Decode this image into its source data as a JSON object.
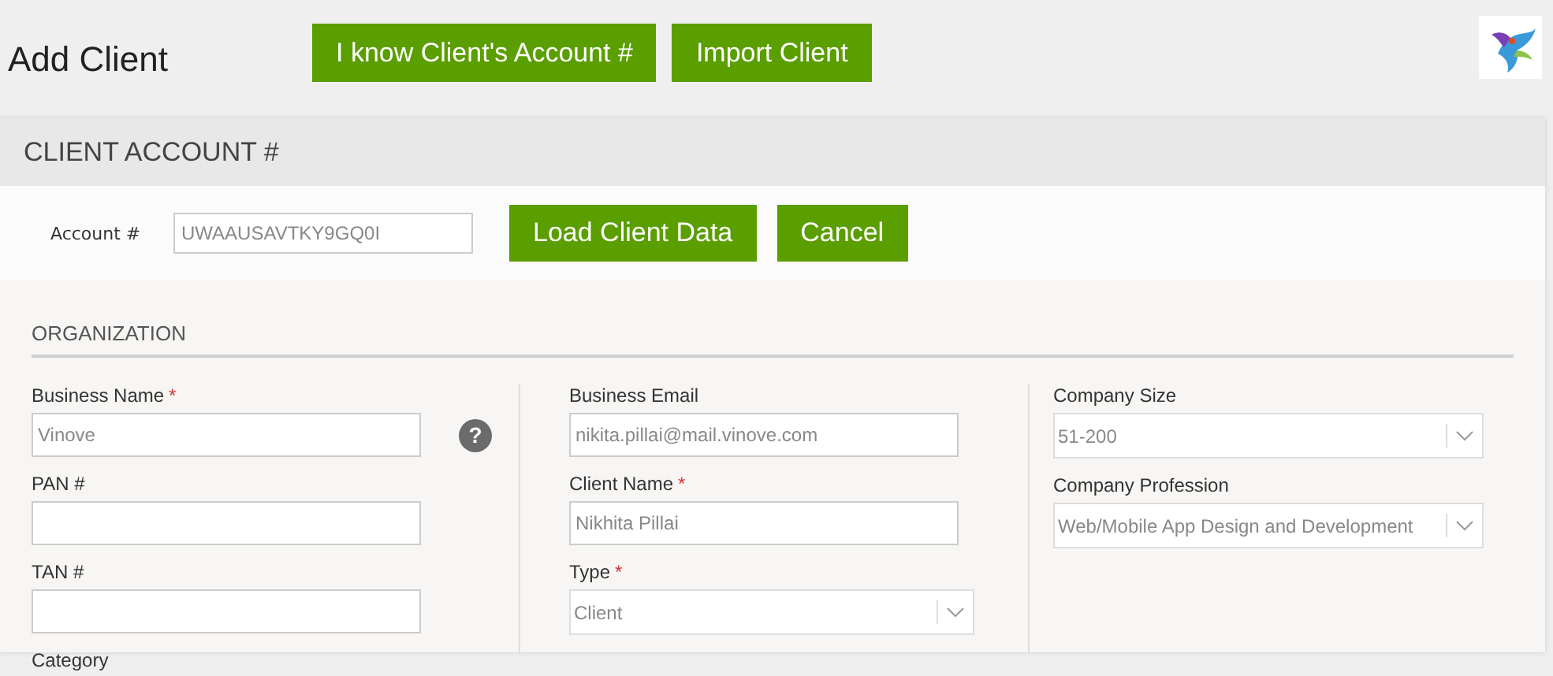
{
  "page_title": "Add Client",
  "header_buttons": [
    "I know Client's Account #",
    "Import Client"
  ],
  "client_account": {
    "title": "CLIENT ACCOUNT #",
    "label": "Account #",
    "value": "UWAAUSAVTKY9GQ0I",
    "buttons": [
      "Load Client Data",
      "Cancel"
    ]
  },
  "organization": {
    "title": "ORGANIZATION",
    "columns": [
      [
        {
          "kind": "text",
          "label": "Business Name",
          "required_mark": "*",
          "help_icon": "?",
          "value": "Vinove"
        },
        {
          "kind": "text",
          "label": "PAN #"
        },
        {
          "kind": "text",
          "label": "TAN #"
        },
        {
          "kind": "label",
          "label": "Category"
        }
      ],
      [
        {
          "kind": "text",
          "label": "Business Email",
          "value": "nikita.pillai@mail.vinove.com"
        },
        {
          "kind": "text",
          "label": "Client Name",
          "required_mark": "*",
          "value": "Nikhita Pillai"
        },
        {
          "kind": "select",
          "label": "Type",
          "required_mark": "*",
          "value": "Client"
        }
      ],
      [
        {
          "kind": "select",
          "label": "Company Size",
          "value": "51-200"
        },
        {
          "kind": "select",
          "label": "Company Profession",
          "value": "Web/Mobile App Design and Development"
        }
      ]
    ]
  }
}
